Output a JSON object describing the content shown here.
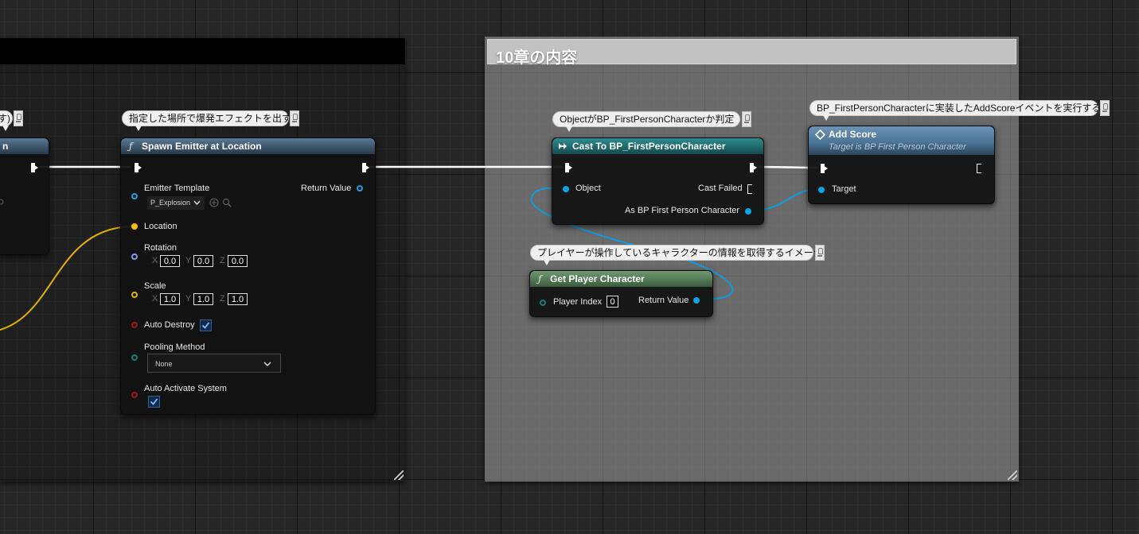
{
  "comment_boxes": {
    "left": {
      "title": ""
    },
    "right": {
      "title": "10章の内容"
    }
  },
  "partial_node": {
    "title_fragment": "n",
    "bubble_fragment": "す)"
  },
  "spawn_emitter": {
    "comment": "指定した場所で爆発エフェクトを出す",
    "title": "Spawn Emitter at Location",
    "emitter_template_label": "Emitter Template",
    "emitter_template_value": "P_Explosion",
    "return_value_label": "Return Value",
    "location_label": "Location",
    "rotation_label": "Rotation",
    "rotation": {
      "x_label": "X",
      "x": "0.0",
      "y_label": "Y",
      "y": "0.0",
      "z_label": "Z",
      "z": "0.0"
    },
    "scale_label": "Scale",
    "scale": {
      "x_label": "X",
      "x": "1.0",
      "y_label": "Y",
      "y": "1.0",
      "z_label": "Z",
      "z": "1.0"
    },
    "auto_destroy_label": "Auto Destroy",
    "auto_destroy": true,
    "pooling_method_label": "Pooling Method",
    "pooling_method_value": "None",
    "auto_activate_label": "Auto Activate System",
    "auto_activate": true
  },
  "cast_node": {
    "comment": "ObjectがBP_FirstPersonCharacterか判定",
    "title": "Cast To BP_FirstPersonCharacter",
    "object_label": "Object",
    "cast_failed_label": "Cast Failed",
    "as_label": "As BP First Person Character"
  },
  "add_score": {
    "comment": "BP_FirstPersonCharacterに実装したAddScoreイベントを実行する",
    "title": "Add Score",
    "subtitle": "Target is BP First Person Character",
    "target_label": "Target"
  },
  "get_player": {
    "comment": "プレイヤーが操作しているキャラクターの情報を取得するイメージ",
    "title": "Get Player Character",
    "player_index_label": "Player Index",
    "player_index_value": "0",
    "return_value_label": "Return Value"
  },
  "colors": {
    "exec_wire": "#ffffff",
    "object_wire": "#0e9de0",
    "vector_wire": "#e0b200",
    "spawn_title": "#3a5266",
    "cast_title": "#1e6668",
    "get_player_title": "#4e7651",
    "add_score_title": "#4d7596"
  },
  "icons": {
    "function": "f-function-icon",
    "cast": "cast-icon",
    "event": "event-diamond-icon"
  }
}
